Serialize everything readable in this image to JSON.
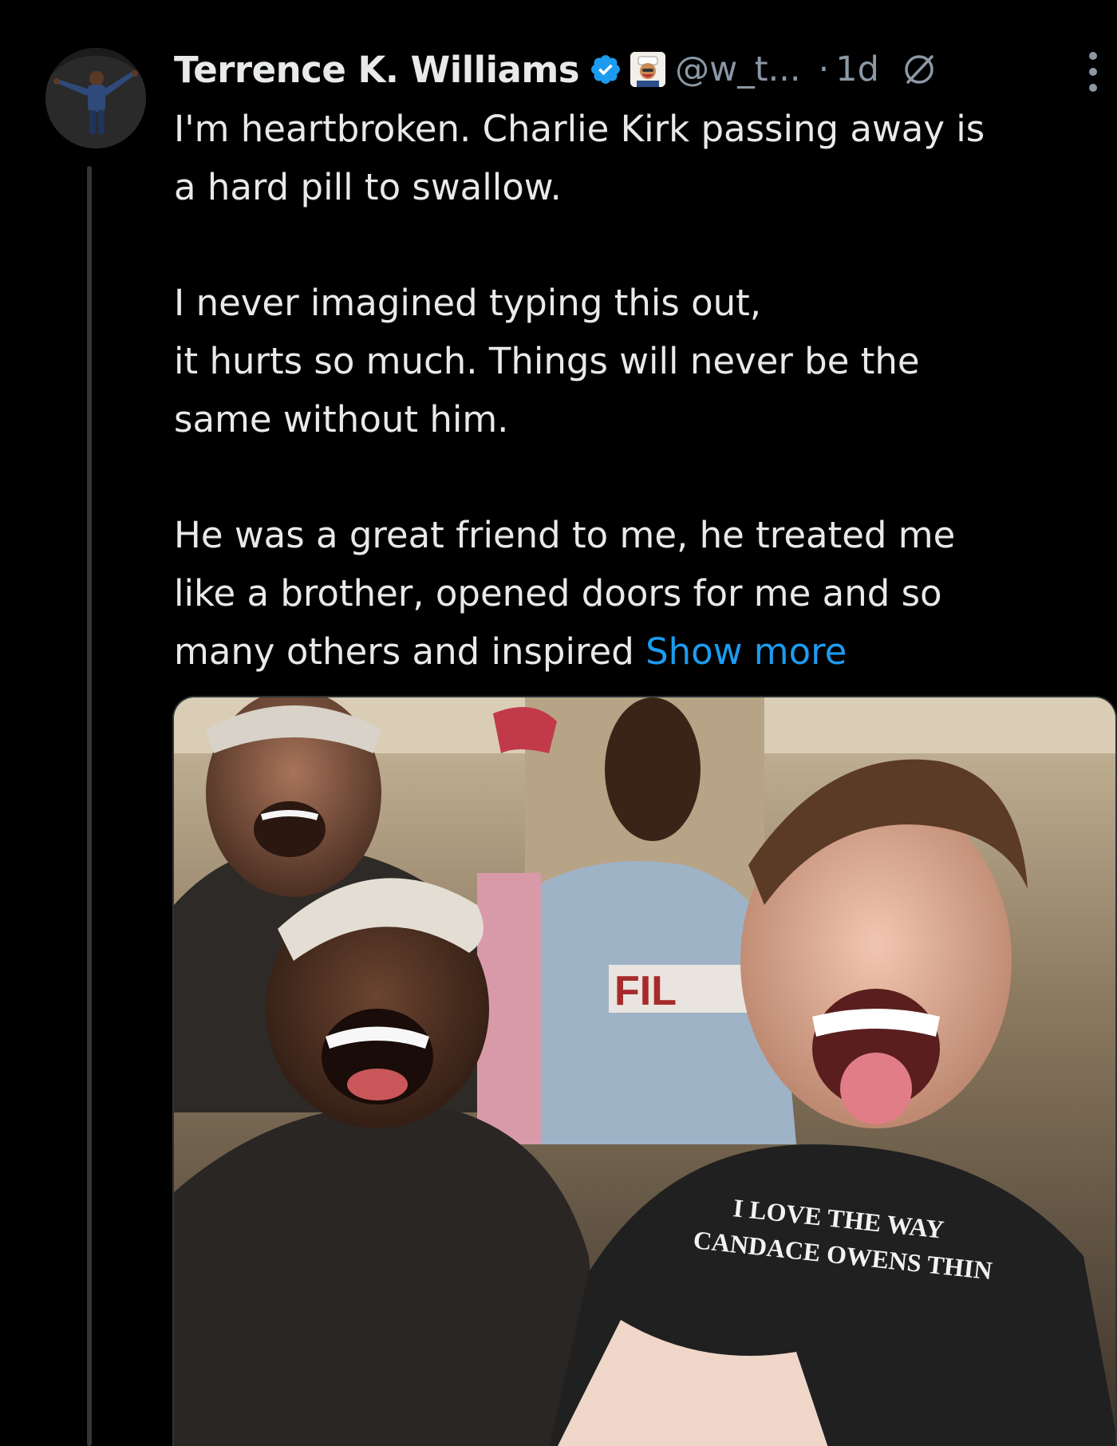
{
  "tweet": {
    "author": {
      "display_name": "Terrence K. Williams",
      "handle": "@w_t...",
      "verified_icon": "verified-badge-icon",
      "affiliate_icon": "affiliate-badge-icon",
      "avatar_icon": "avatar"
    },
    "timestamp": "1d",
    "separator": "·",
    "grok_icon": "grok-icon",
    "more_icon": "more-vertical-icon",
    "body": {
      "paragraph_1_line_1": "I'm heartbroken. Charlie Kirk passing away is",
      "paragraph_1_line_2": "a hard pill to swallow.",
      "paragraph_2_line_1": "I never imagined typing this out,",
      "paragraph_2_line_2": "it hurts so much. Things will never be the",
      "paragraph_2_line_3": "same without him.",
      "paragraph_3_line_1": "He was a great friend to me, he treated me",
      "paragraph_3_line_2": "like a brother, opened doors for me and so",
      "paragraph_3_line_3": "many others and inspired "
    },
    "show_more_label": "Show more",
    "media": {
      "shirt_text_line_1": "I LOVE THE WAY",
      "shirt_text_line_2": "CANDACE OWENS THIN"
    },
    "colors": {
      "background": "#000000",
      "text": "#e7e9ea",
      "secondary_text": "#8b98a5",
      "link": "#1d9bf0",
      "verified": "#1d9bf0"
    }
  }
}
